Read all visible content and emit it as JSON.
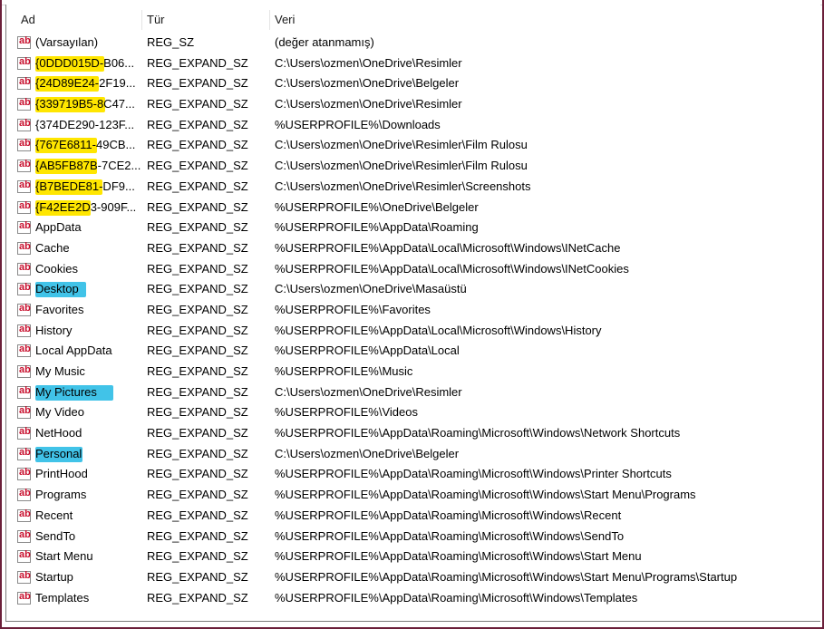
{
  "columns": {
    "name": "Ad",
    "type": "Tür",
    "data": "Veri"
  },
  "colors": {
    "highlight_yellow": "#ffe600",
    "highlight_blue": "#41c3e8",
    "icon_text": "#c8102e"
  },
  "rows": [
    {
      "name": "(Varsayılan)",
      "type": "REG_SZ",
      "data": "(değer atanmamış)",
      "highlight": "none",
      "icon": "string-value-icon"
    },
    {
      "name": "{0DDD015D-B06...",
      "type": "REG_EXPAND_SZ",
      "data": "C:\\Users\\ozmen\\OneDrive\\Resimler",
      "highlight": "yellow",
      "icon": "string-value-icon"
    },
    {
      "name": "{24D89E24-2F19...",
      "type": "REG_EXPAND_SZ",
      "data": "C:\\Users\\ozmen\\OneDrive\\Belgeler",
      "highlight": "yellow",
      "icon": "string-value-icon"
    },
    {
      "name": "{339719B5-8C47...",
      "type": "REG_EXPAND_SZ",
      "data": "C:\\Users\\ozmen\\OneDrive\\Resimler",
      "highlight": "yellow",
      "icon": "string-value-icon"
    },
    {
      "name": "{374DE290-123F...",
      "type": "REG_EXPAND_SZ",
      "data": "%USERPROFILE%\\Downloads",
      "highlight": "none",
      "icon": "string-value-icon"
    },
    {
      "name": "{767E6811-49CB...",
      "type": "REG_EXPAND_SZ",
      "data": "C:\\Users\\ozmen\\OneDrive\\Resimler\\Film Rulosu",
      "highlight": "yellow",
      "icon": "string-value-icon"
    },
    {
      "name": "{AB5FB87B-7CE2...",
      "type": "REG_EXPAND_SZ",
      "data": "C:\\Users\\ozmen\\OneDrive\\Resimler\\Film Rulosu",
      "highlight": "yellow",
      "icon": "string-value-icon"
    },
    {
      "name": "{B7BEDE81-DF9...",
      "type": "REG_EXPAND_SZ",
      "data": "C:\\Users\\ozmen\\OneDrive\\Resimler\\Screenshots",
      "highlight": "yellow",
      "icon": "string-value-icon"
    },
    {
      "name": "{F42EE2D3-909F...",
      "type": "REG_EXPAND_SZ",
      "data": "%USERPROFILE%\\OneDrive\\Belgeler",
      "highlight": "yellow",
      "icon": "string-value-icon"
    },
    {
      "name": "AppData",
      "type": "REG_EXPAND_SZ",
      "data": "%USERPROFILE%\\AppData\\Roaming",
      "highlight": "none",
      "icon": "string-value-icon"
    },
    {
      "name": "Cache",
      "type": "REG_EXPAND_SZ",
      "data": "%USERPROFILE%\\AppData\\Local\\Microsoft\\Windows\\INetCache",
      "highlight": "none",
      "icon": "string-value-icon"
    },
    {
      "name": "Cookies",
      "type": "REG_EXPAND_SZ",
      "data": "%USERPROFILE%\\AppData\\Local\\Microsoft\\Windows\\INetCookies",
      "highlight": "none",
      "icon": "string-value-icon"
    },
    {
      "name": "Desktop",
      "type": "REG_EXPAND_SZ",
      "data": "C:\\Users\\ozmen\\OneDrive\\Masaüstü",
      "highlight": "blue",
      "icon": "string-value-icon"
    },
    {
      "name": "Favorites",
      "type": "REG_EXPAND_SZ",
      "data": "%USERPROFILE%\\Favorites",
      "highlight": "none",
      "icon": "string-value-icon"
    },
    {
      "name": "History",
      "type": "REG_EXPAND_SZ",
      "data": "%USERPROFILE%\\AppData\\Local\\Microsoft\\Windows\\History",
      "highlight": "none",
      "icon": "string-value-icon"
    },
    {
      "name": "Local AppData",
      "type": "REG_EXPAND_SZ",
      "data": "%USERPROFILE%\\AppData\\Local",
      "highlight": "none",
      "icon": "string-value-icon"
    },
    {
      "name": "My Music",
      "type": "REG_EXPAND_SZ",
      "data": "%USERPROFILE%\\Music",
      "highlight": "none",
      "icon": "string-value-icon"
    },
    {
      "name": "My Pictures",
      "type": "REG_EXPAND_SZ",
      "data": "C:\\Users\\ozmen\\OneDrive\\Resimler",
      "highlight": "blue",
      "icon": "string-value-icon"
    },
    {
      "name": "My Video",
      "type": "REG_EXPAND_SZ",
      "data": "%USERPROFILE%\\Videos",
      "highlight": "none",
      "icon": "string-value-icon"
    },
    {
      "name": "NetHood",
      "type": "REG_EXPAND_SZ",
      "data": "%USERPROFILE%\\AppData\\Roaming\\Microsoft\\Windows\\Network Shortcuts",
      "highlight": "none",
      "icon": "string-value-icon"
    },
    {
      "name": "Personal",
      "type": "REG_EXPAND_SZ",
      "data": "C:\\Users\\ozmen\\OneDrive\\Belgeler",
      "highlight": "blue",
      "icon": "string-value-icon"
    },
    {
      "name": "PrintHood",
      "type": "REG_EXPAND_SZ",
      "data": "%USERPROFILE%\\AppData\\Roaming\\Microsoft\\Windows\\Printer Shortcuts",
      "highlight": "none",
      "icon": "string-value-icon"
    },
    {
      "name": "Programs",
      "type": "REG_EXPAND_SZ",
      "data": "%USERPROFILE%\\AppData\\Roaming\\Microsoft\\Windows\\Start Menu\\Programs",
      "highlight": "none",
      "icon": "string-value-icon"
    },
    {
      "name": "Recent",
      "type": "REG_EXPAND_SZ",
      "data": "%USERPROFILE%\\AppData\\Roaming\\Microsoft\\Windows\\Recent",
      "highlight": "none",
      "icon": "string-value-icon"
    },
    {
      "name": "SendTo",
      "type": "REG_EXPAND_SZ",
      "data": "%USERPROFILE%\\AppData\\Roaming\\Microsoft\\Windows\\SendTo",
      "highlight": "none",
      "icon": "string-value-icon"
    },
    {
      "name": "Start Menu",
      "type": "REG_EXPAND_SZ",
      "data": "%USERPROFILE%\\AppData\\Roaming\\Microsoft\\Windows\\Start Menu",
      "highlight": "none",
      "icon": "string-value-icon"
    },
    {
      "name": "Startup",
      "type": "REG_EXPAND_SZ",
      "data": "%USERPROFILE%\\AppData\\Roaming\\Microsoft\\Windows\\Start Menu\\Programs\\Startup",
      "highlight": "none",
      "icon": "string-value-icon"
    },
    {
      "name": "Templates",
      "type": "REG_EXPAND_SZ",
      "data": "%USERPROFILE%\\AppData\\Roaming\\Microsoft\\Windows\\Templates",
      "highlight": "none",
      "icon": "string-value-icon"
    }
  ]
}
